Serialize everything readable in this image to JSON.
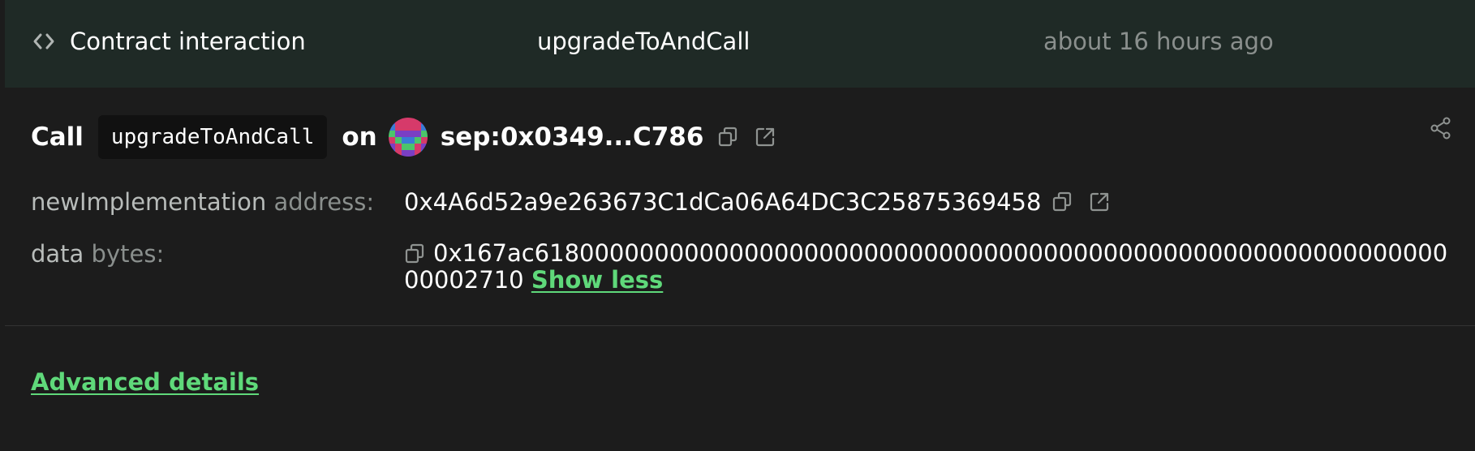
{
  "header": {
    "type_label": "Contract interaction",
    "method": "upgradeToAndCall",
    "time": "about 16 hours ago"
  },
  "call": {
    "prefix": "Call",
    "method": "upgradeToAndCall",
    "on": "on",
    "address": "sep:0x0349...C786"
  },
  "params": [
    {
      "name": "newImplementation",
      "type": "address:",
      "value": "0x4A6d52a9e263673C1dCa06A64DC3C25875369458"
    },
    {
      "name": "data",
      "type": "bytes:",
      "value": "0x167ac618000000000000000000000000000000000000000000000000000000000000002710",
      "toggle": "Show less"
    }
  ],
  "advanced_details": "Advanced details",
  "colors": {
    "header_bg": "#1f2a26",
    "panel_bg": "#1c1c1c",
    "accent_green": "#5fd97a",
    "muted_text": "#8a8f8d"
  },
  "icons": {
    "header": "code-icon",
    "copy": "copy-icon",
    "external": "external-link-icon",
    "share": "share-icon"
  }
}
